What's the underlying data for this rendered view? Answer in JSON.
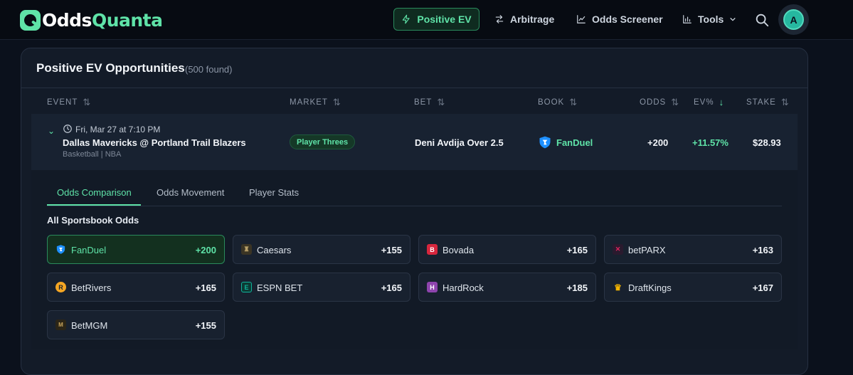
{
  "brand": {
    "odds": "Odds",
    "quanta": "Quanta"
  },
  "nav": {
    "positive_ev": "Positive EV",
    "arbitrage": "Arbitrage",
    "odds_screener": "Odds Screener",
    "tools": "Tools",
    "avatar_initial": "A"
  },
  "panel": {
    "title": "Positive EV Opportunities",
    "count": "(500 found)"
  },
  "columns": {
    "event": "EVENT",
    "market": "MARKET",
    "bet": "BET",
    "book": "BOOK",
    "odds": "ODDS",
    "ev": "EV%",
    "stake": "STAKE"
  },
  "row": {
    "time": "Fri, Mar 27 at 7:10 PM",
    "event": "Dallas Mavericks @ Portland Trail Blazers",
    "league": "Basketball | NBA",
    "market": "Player Threes",
    "bet": "Deni Avdija Over 2.5",
    "book": "FanDuel",
    "odds": "+200",
    "ev": "+11.57%",
    "stake": "$28.93"
  },
  "detail_tabs": {
    "comparison": "Odds Comparison",
    "movement": "Odds Movement",
    "player_stats": "Player Stats"
  },
  "sportsbook_title": "All Sportsbook Odds",
  "books": [
    {
      "name": "FanDuel",
      "odds": "+200",
      "icon": "fanduel-shield-icon",
      "color": "#1e90ff"
    },
    {
      "name": "Caesars",
      "odds": "+155",
      "icon": "caesars-icon",
      "color": "#b8a16a"
    },
    {
      "name": "Bovada",
      "odds": "+165",
      "icon": "bovada-icon",
      "color": "#d7263d"
    },
    {
      "name": "betPARX",
      "odds": "+163",
      "icon": "betparx-icon",
      "color": "#e0245e"
    },
    {
      "name": "BetRivers",
      "odds": "+165",
      "icon": "betrivers-icon",
      "color": "#f5a623"
    },
    {
      "name": "ESPN BET",
      "odds": "+165",
      "icon": "espnbet-icon",
      "color": "#0fb39c"
    },
    {
      "name": "HardRock",
      "odds": "+185",
      "icon": "hardrock-icon",
      "color": "#8e44ad"
    },
    {
      "name": "DraftKings",
      "odds": "+167",
      "icon": "draftkings-icon",
      "color": "#f4b400"
    },
    {
      "name": "BetMGM",
      "odds": "+155",
      "icon": "betmgm-icon",
      "color": "#c9a55c"
    }
  ],
  "colors": {
    "accent": "#5fe3a8",
    "background": "#0b111c",
    "panel": "#131b28"
  }
}
